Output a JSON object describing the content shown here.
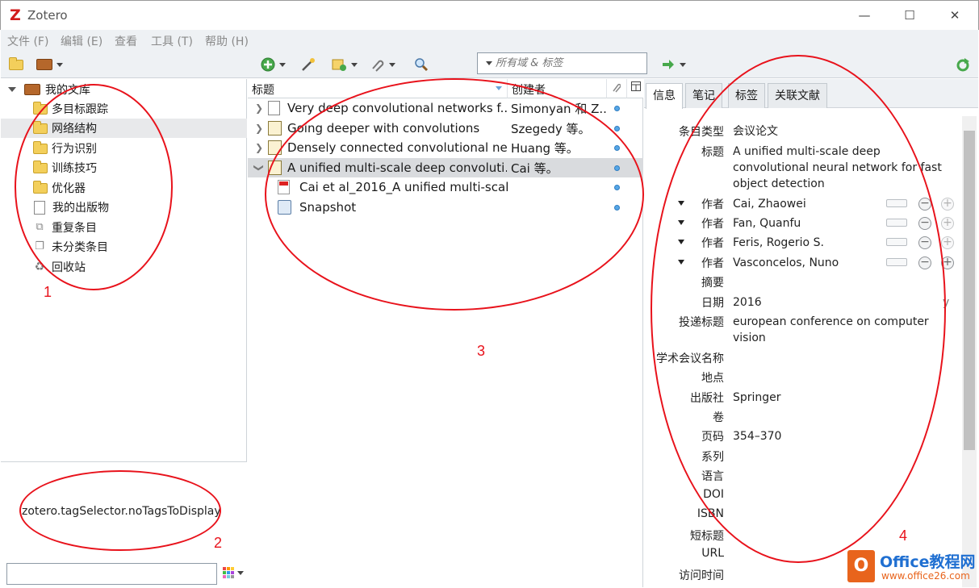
{
  "window": {
    "title": "Zotero",
    "minimize": "—",
    "maximize": "☐",
    "close": "✕"
  },
  "menu": [
    "文件 (F)",
    "编辑 (E)",
    "查看",
    "工具 (T)",
    "帮助 (H)"
  ],
  "search": {
    "placeholder": "所有域 & 标签"
  },
  "collections": {
    "library": "我的文库",
    "items": [
      "多目标跟踪",
      "网络结构",
      "行为识别",
      "训练技巧",
      "优化器",
      "我的出版物",
      "重复条目",
      "未分类条目",
      "回收站"
    ]
  },
  "tags": {
    "empty_message": "zotero.tagSelector.noTagsToDisplay"
  },
  "columns": {
    "title": "标题",
    "creator": "创建者"
  },
  "items": [
    {
      "title": "Very deep convolutional networks f...",
      "creator": "Simonyan 和 Z..."
    },
    {
      "title": "Going deeper with convolutions",
      "creator": "Szegedy 等。"
    },
    {
      "title": "Densely connected convolutional ne...",
      "creator": "Huang 等。"
    },
    {
      "title": "A unified multi-scale deep convoluti...",
      "creator": "Cai 等。"
    }
  ],
  "attachments": [
    {
      "title": "Cai et al_2016_A unified multi-scal..."
    },
    {
      "title": "Snapshot"
    }
  ],
  "tabs": [
    "信息",
    "笔记",
    "标签",
    "关联文献"
  ],
  "info": {
    "item_type_label": "条目类型",
    "item_type": "会议论文",
    "title_label": "标题",
    "title": "A unified multi-scale deep convolutional neural network for fast object detection",
    "author_label": "作者",
    "authors": [
      "Cai, Zhaowei",
      "Fan, Quanfu",
      "Feris, Rogerio S.",
      "Vasconcelos, Nuno"
    ],
    "abstract_label": "摘要",
    "date_label": "日期",
    "date": "2016",
    "date_suffix": "y",
    "proceedings_label": "投递标题",
    "proceedings": "european conference on computer vision",
    "conference_label": "学术会议名称",
    "place_label": "地点",
    "publisher_label": "出版社",
    "publisher": "Springer",
    "volume_label": "卷",
    "pages_label": "页码",
    "pages": "354–370",
    "series_label": "系列",
    "language_label": "语言",
    "doi_label": "DOI",
    "isbn_label": "ISBN",
    "short_title_label": "短标题",
    "url_label": "URL",
    "accessed_label": "访问时间"
  },
  "annotations": [
    "1",
    "2",
    "3",
    "4"
  ],
  "watermark": {
    "logo": "O",
    "line1": "Office教程网",
    "line2": "www.office26.com"
  },
  "colors": {
    "annotation": "#e8121b",
    "selection": "#d9dbde",
    "accent": "#d11b1b"
  }
}
